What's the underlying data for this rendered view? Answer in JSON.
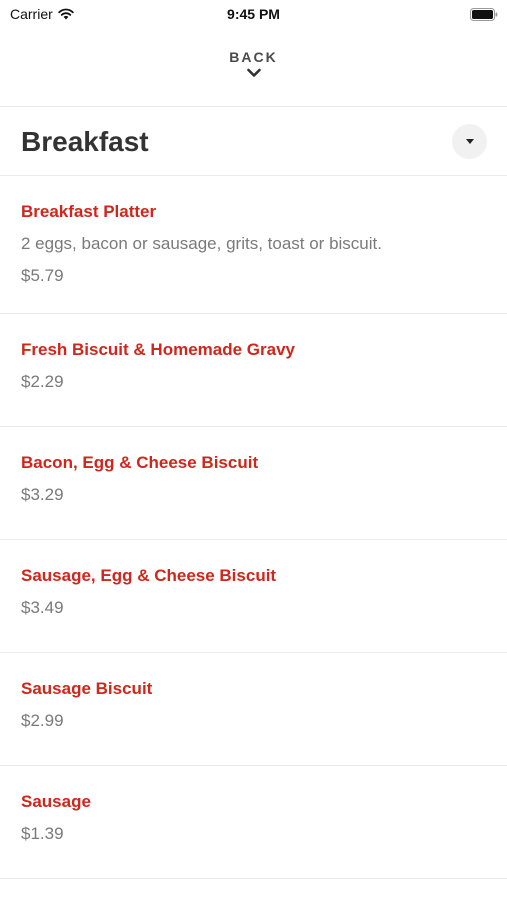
{
  "status_bar": {
    "carrier": "Carrier",
    "time": "9:45 PM"
  },
  "nav": {
    "back_label": "BACK"
  },
  "category": {
    "title": "Breakfast"
  },
  "menu_items": [
    {
      "name": "Breakfast Platter",
      "description": "2 eggs, bacon or sausage, grits, toast or biscuit.",
      "price": "$5.79"
    },
    {
      "name": "Fresh Biscuit & Homemade Gravy",
      "price": "$2.29"
    },
    {
      "name": "Bacon, Egg & Cheese Biscuit",
      "price": "$3.29"
    },
    {
      "name": "Sausage, Egg & Cheese Biscuit",
      "price": "$3.49"
    },
    {
      "name": "Sausage Biscuit",
      "price": "$2.99"
    },
    {
      "name": "Sausage",
      "price": "$1.39"
    }
  ],
  "colors": {
    "accent": "#d0261b",
    "text": "#333333",
    "muted": "#7a7a7a",
    "divider": "#ececec"
  },
  "icons": {
    "wifi": "wifi-icon",
    "battery": "battery-icon",
    "back": "chevron-down-icon",
    "dropdown": "caret-down-icon"
  }
}
